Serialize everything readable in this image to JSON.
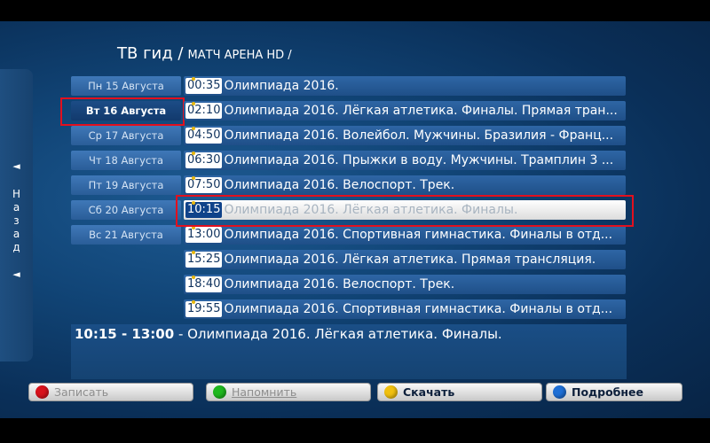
{
  "header": {
    "title": "ТВ гид /",
    "channel": "МАТЧ АРЕНА HD /"
  },
  "back_panel": {
    "arrow_top": "◄",
    "label": "Н\nа\nз\nа\nд",
    "arrow_bottom": "◄"
  },
  "days": [
    {
      "label": "Пн 15 Августа"
    },
    {
      "label": "Вт 16 Августа"
    },
    {
      "label": "Ср 17 Августа"
    },
    {
      "label": "Чт 18 Августа"
    },
    {
      "label": "Пт 19 Августа"
    },
    {
      "label": "Сб 20 Августа"
    },
    {
      "label": "Вс 21 Августа"
    }
  ],
  "selected_day": "Вт 16 Августа",
  "programs": [
    {
      "time": "00:35",
      "title": "Олимпиада 2016."
    },
    {
      "time": "02:10",
      "title": "Олимпиада 2016. Лёгкая атлетика. Финалы. Прямая тран..."
    },
    {
      "time": "04:50",
      "title": "Олимпиада 2016. Волейбол. Мужчины. Бразилия - Франц..."
    },
    {
      "time": "06:30",
      "title": "Олимпиада 2016. Прыжки в воду. Мужчины. Трамплин 3 ..."
    },
    {
      "time": "07:50",
      "title": "Олимпиада 2016. Велоспорт. Трек."
    },
    {
      "time": "10:15",
      "title": "Олимпиада 2016. Лёгкая атлетика. Финалы."
    },
    {
      "time": "13:00",
      "title": "Олимпиада 2016. Спортивная гимнастика. Финалы в отд..."
    },
    {
      "time": "15:25",
      "title": "Олимпиада 2016. Лёгкая атлетика. Прямая трансляция."
    },
    {
      "time": "18:40",
      "title": "Олимпиада 2016. Велоспорт. Трек."
    },
    {
      "time": "19:55",
      "title": "Олимпиада 2016. Спортивная гимнастика. Финалы в отд..."
    }
  ],
  "selected_program": "10:15",
  "info": {
    "range": "10:15 - 13:00",
    "title": " - Олимпиада 2016. Лёгкая атлетика. Финалы."
  },
  "buttons": [
    {
      "label": "Записать",
      "color": "#d8121c",
      "icon": "red-circle-icon"
    },
    {
      "label": "Напомнить",
      "color": "#1fb81f",
      "icon": "green-circle-icon"
    },
    {
      "label": "Скачать",
      "color": "#f0c010",
      "icon": "yellow-circle-icon"
    },
    {
      "label": "Подробнее",
      "color": "#1e6fd6",
      "icon": "blue-circle-icon"
    }
  ]
}
